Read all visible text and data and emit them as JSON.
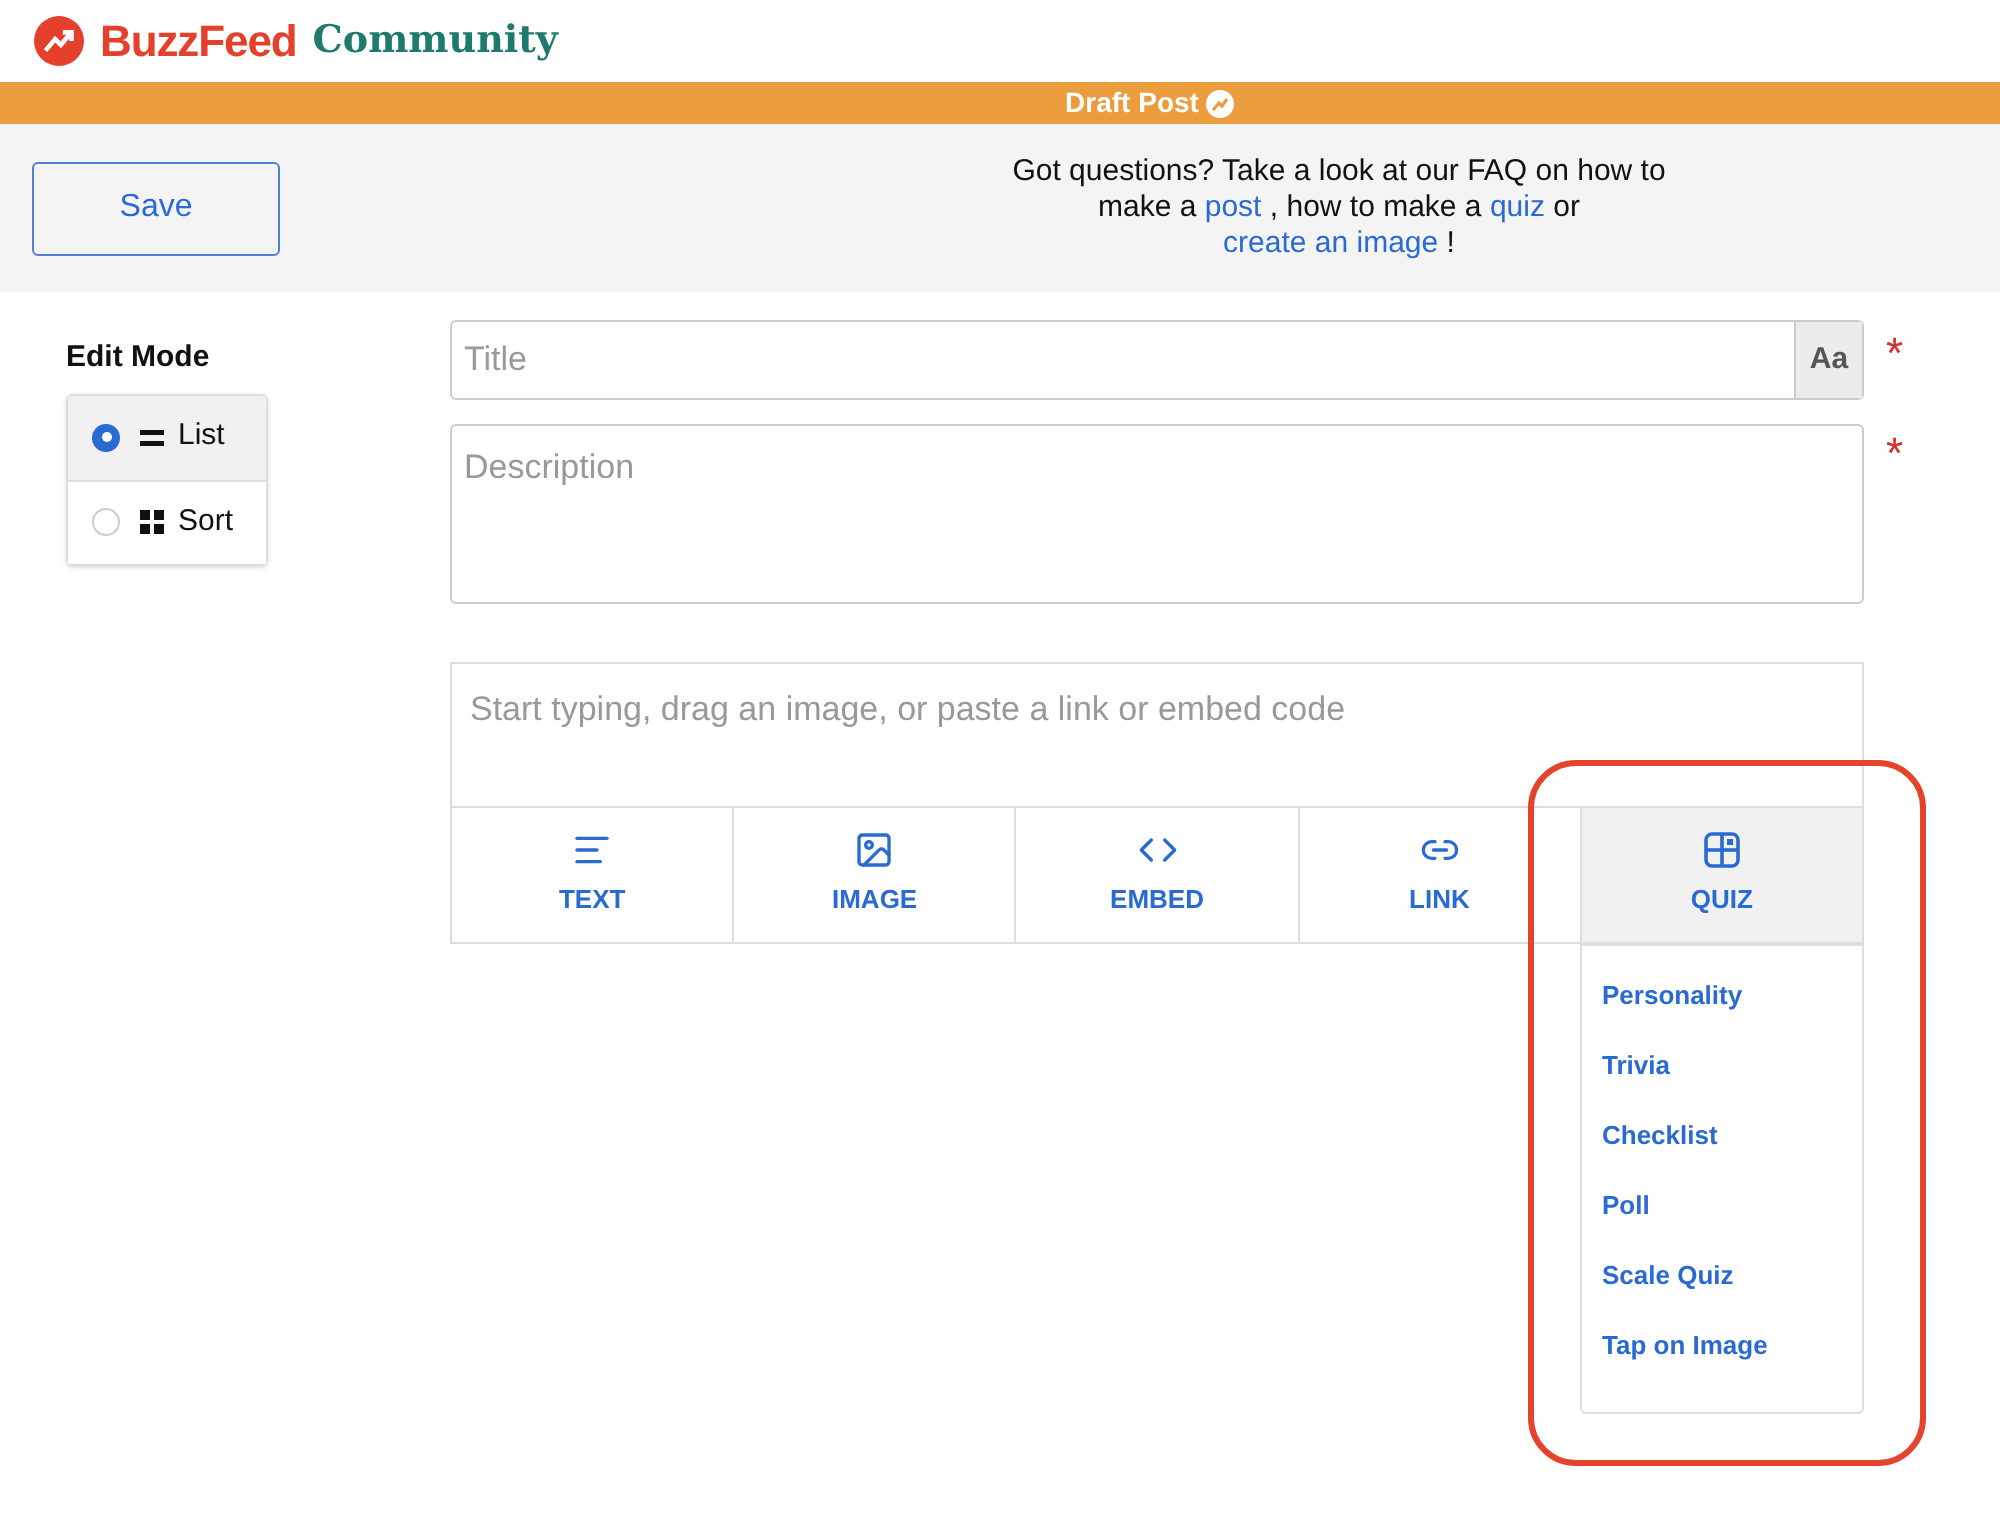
{
  "header": {
    "brand": "BuzzFeed",
    "section": "Community"
  },
  "status_bar": {
    "label": "Draft Post"
  },
  "toolbar": {
    "save_button": "Save",
    "faq": [
      {
        "kind": "text",
        "text": "Got questions? Take a look at our FAQ on how to make a "
      },
      {
        "kind": "link",
        "text": "post"
      },
      {
        "kind": "text",
        "text": " , how to make a "
      },
      {
        "kind": "link",
        "text": "quiz"
      },
      {
        "kind": "text",
        "text": " or "
      },
      {
        "kind": "link",
        "text": "create an image"
      },
      {
        "kind": "text",
        "text": " !"
      }
    ]
  },
  "edit_mode": {
    "title": "Edit Mode",
    "options": [
      {
        "label": "List",
        "kind": "list",
        "selected": true
      },
      {
        "label": "Sort",
        "kind": "sort",
        "selected": false
      }
    ]
  },
  "form": {
    "title": {
      "placeholder": "Title",
      "format_button": "Aa",
      "required_mark": "*"
    },
    "description": {
      "placeholder": "Description",
      "required_mark": "*"
    },
    "editor": {
      "placeholder": "Start typing, drag an image, or paste a link or embed code"
    }
  },
  "blocks": [
    {
      "label": "TEXT",
      "kind": "text",
      "selected": false
    },
    {
      "label": "IMAGE",
      "kind": "image",
      "selected": false
    },
    {
      "label": "EMBED",
      "kind": "embed",
      "selected": false
    },
    {
      "label": "LINK",
      "kind": "link",
      "selected": false
    },
    {
      "label": "QUIZ",
      "kind": "quiz",
      "selected": true
    }
  ],
  "quiz_menu": [
    "Personality",
    "Trivia",
    "Checklist",
    "Poll",
    "Scale Quiz",
    "Tap on Image"
  ]
}
